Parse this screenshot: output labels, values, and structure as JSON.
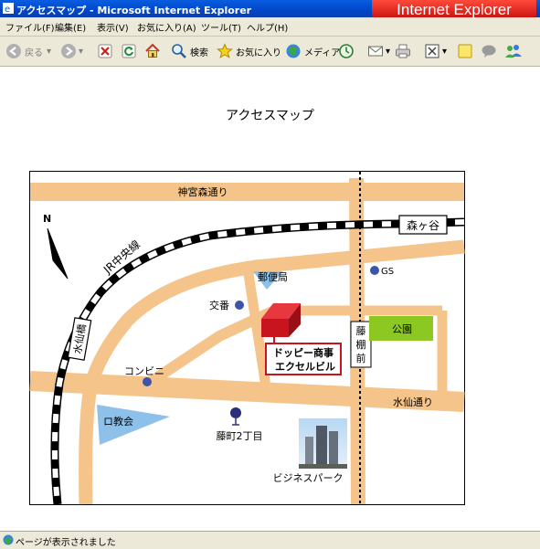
{
  "window": {
    "title": "アクセスマップ - Microsoft Internet Explorer",
    "brand": "Internet Explorer"
  },
  "menu": [
    "ファイル(F)",
    "編集(E)",
    "表示(V)",
    "お気に入り(A)",
    "ツール(T)",
    "ヘルプ(H)"
  ],
  "toolbar": {
    "back": "戻る",
    "search": "検索",
    "favorites": "お気に入り",
    "media": "メディア"
  },
  "page": {
    "heading": "アクセスマップ"
  },
  "map": {
    "roads": {
      "jingumori": "神宮森通り",
      "mizusen": "水仙通り",
      "fujidana": [
        "藤",
        "棚",
        "前"
      ]
    },
    "rail": "JR中央線",
    "stations": {
      "morigaya": "森ヶ谷",
      "mizusenbashi": "水仙橋"
    },
    "places": {
      "post": "郵便局",
      "police": "交番",
      "gs": "GS",
      "park": "公園",
      "convenience": "コンビニ",
      "church": "ロ教会",
      "stop": "藤町2丁目",
      "business": "ビジネスパーク"
    },
    "building": [
      "ドッピー商事",
      "エクセルビル"
    ],
    "north": "N"
  },
  "status": {
    "text": "ページが表示されました"
  },
  "colors": {
    "road": "#f5c48a",
    "park": "#8cc821",
    "church": "#8ec1ea",
    "building": "#c8141e",
    "titlebar": "#0a4fd2"
  }
}
